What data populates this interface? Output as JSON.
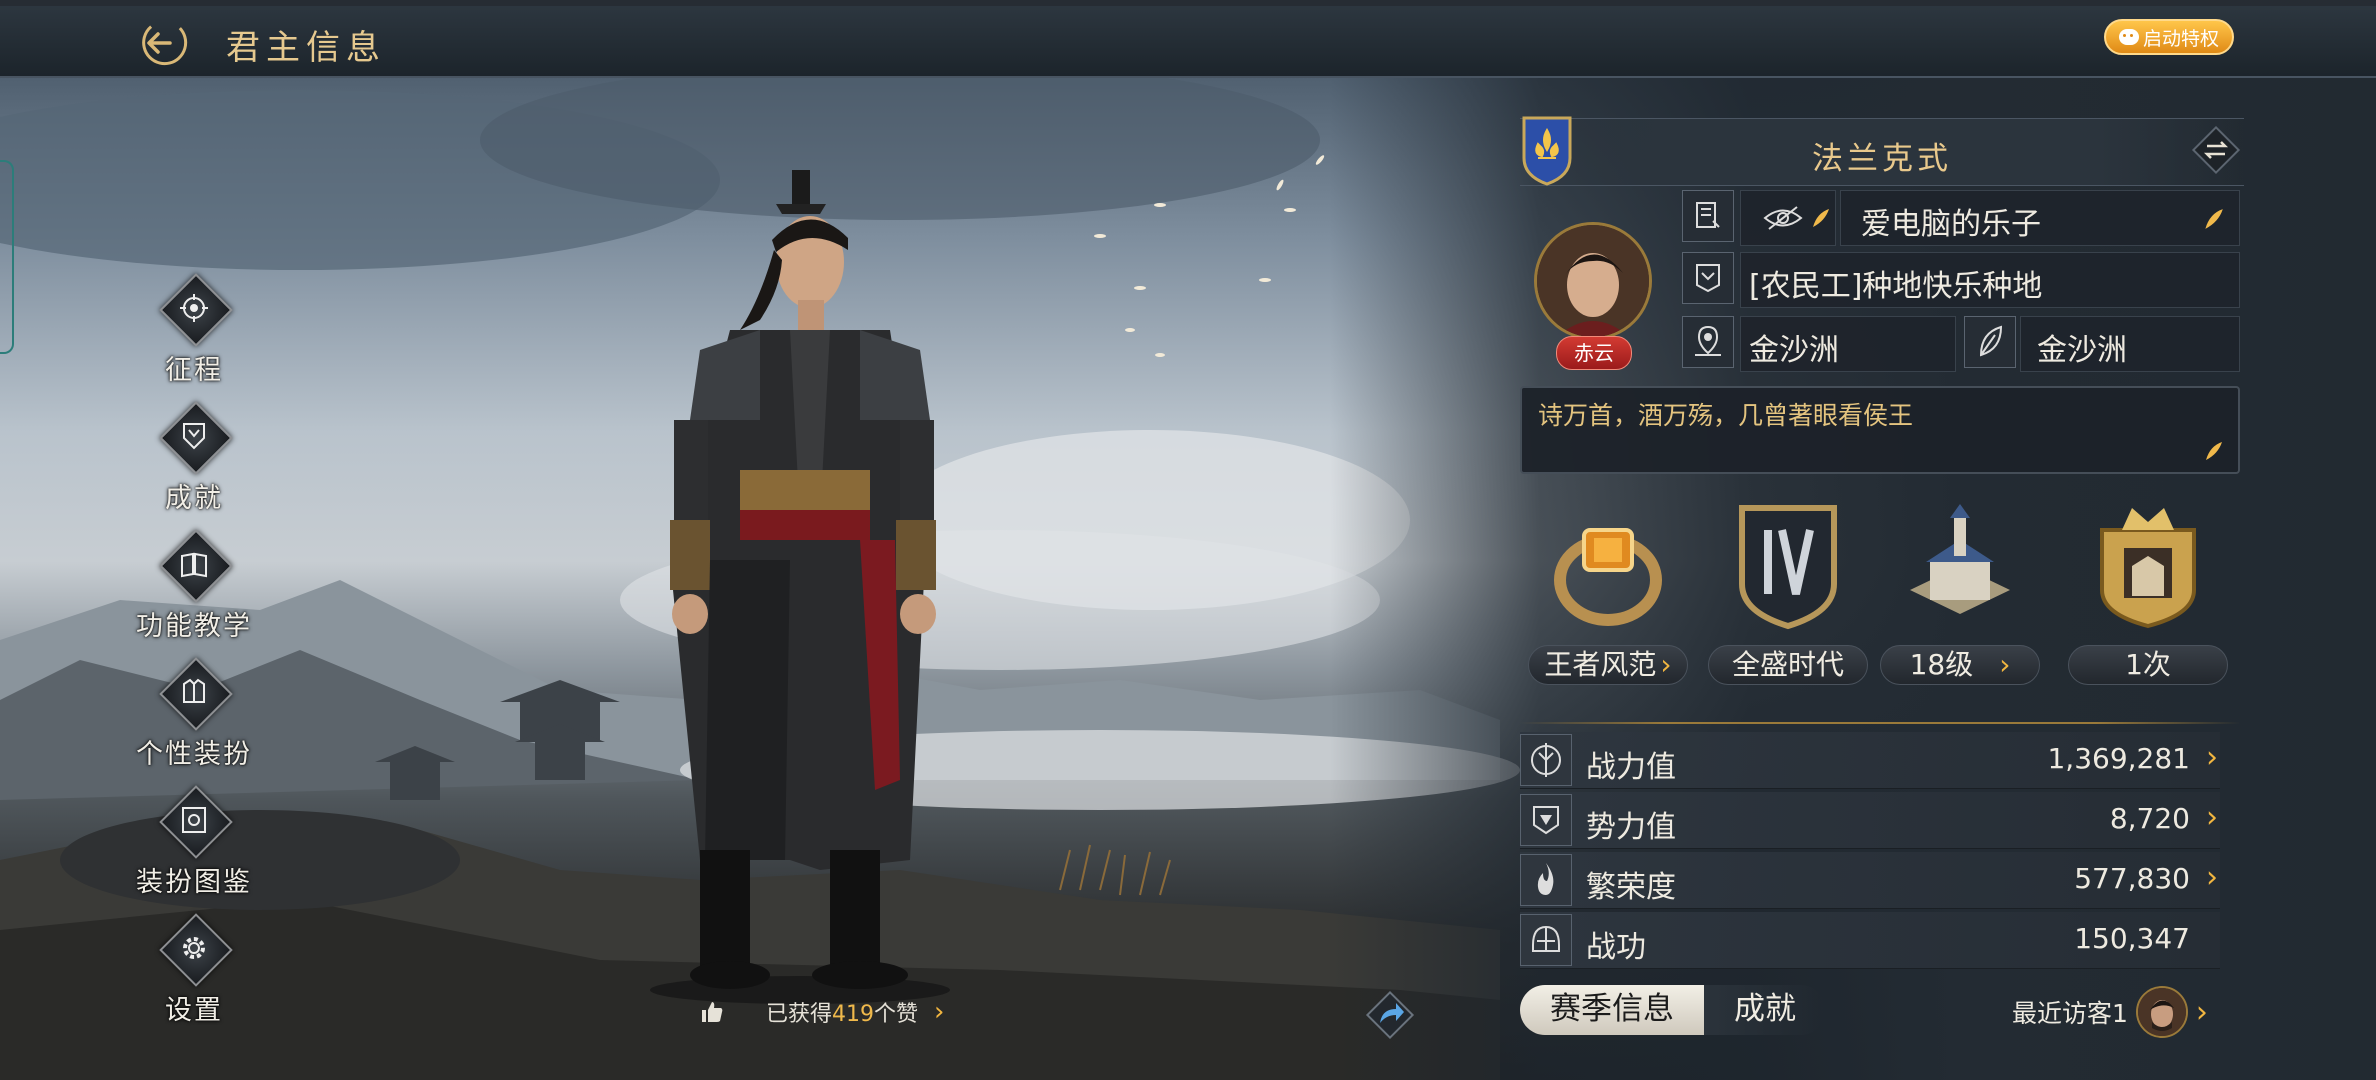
{
  "header": {
    "title": "君主信息",
    "privilege_button": "启动特权"
  },
  "menu": [
    {
      "label": "征程",
      "icon": "journey-icon"
    },
    {
      "label": "成就",
      "icon": "achievement-icon"
    },
    {
      "label": "功能教学",
      "icon": "tutorial-book-icon"
    },
    {
      "label": "个性装扮",
      "icon": "armor-costume-icon"
    },
    {
      "label": "装扮图鉴",
      "icon": "costume-catalog-icon"
    },
    {
      "label": "设置",
      "icon": "gear-icon"
    }
  ],
  "likes": {
    "prefix": "已获得",
    "count": "419",
    "suffix": "个赞"
  },
  "profile": {
    "country": "法兰克式",
    "player_name": "爱电脑的乐子",
    "alliance": "[农民工]种地快乐种地",
    "avatar_tag": "赤云",
    "region_left": "金沙洲",
    "region_right": "金沙洲",
    "signature": "诗万首，酒万殇，几曾著眼看侯王"
  },
  "badges": [
    {
      "label": "王者风范",
      "arrow": true
    },
    {
      "label": "全盛时代",
      "arrow": false
    },
    {
      "label": "18级",
      "arrow": true
    },
    {
      "label": "1次",
      "arrow": false
    }
  ],
  "stats": [
    {
      "label": "战力值",
      "value": "1,369,281",
      "arrow": true
    },
    {
      "label": "势力值",
      "value": "8,720",
      "arrow": true
    },
    {
      "label": "繁荣度",
      "value": "577,830",
      "arrow": true
    },
    {
      "label": "战功",
      "value": "150,347",
      "arrow": false
    }
  ],
  "tabs": {
    "season": "赛季信息",
    "achievement": "成就"
  },
  "visitors": {
    "label": "最近访客1"
  },
  "colors": {
    "accent_gold": "#e9c98c",
    "arrow_gold": "#f2b640",
    "privilege_orange": "#f0a028",
    "tag_red": "#c8302a"
  }
}
